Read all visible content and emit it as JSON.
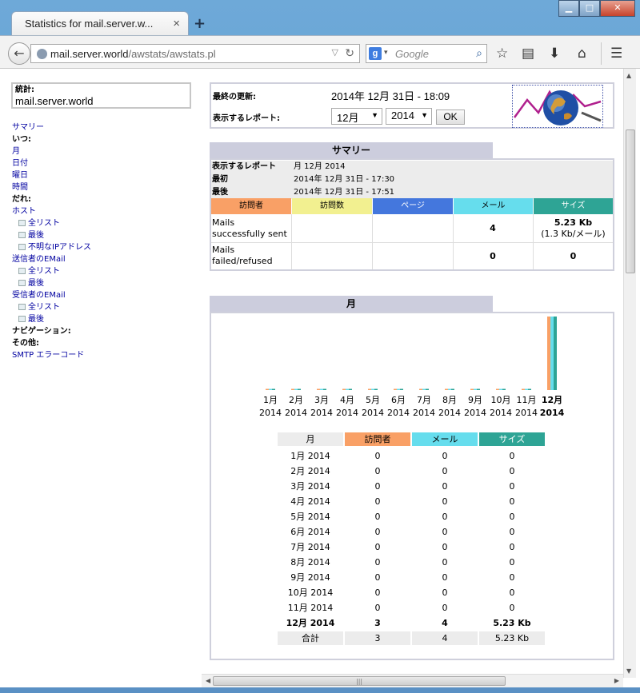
{
  "browser": {
    "tab_title": "Statistics for mail.server.w...",
    "tab_close": "×",
    "new_tab": "+",
    "url_host": "mail.server.world",
    "url_path": "/awstats/awstats.pl",
    "search_placeholder": "Google",
    "search_engine_letter": "g"
  },
  "sidebar": {
    "stats_label": "統計:",
    "hostname": "mail.server.world",
    "items": [
      {
        "type": "link",
        "label": "サマリー"
      },
      {
        "type": "header",
        "label": "いつ:"
      },
      {
        "type": "link",
        "label": "月"
      },
      {
        "type": "link",
        "label": "日付"
      },
      {
        "type": "link",
        "label": "曜日"
      },
      {
        "type": "link",
        "label": "時間"
      },
      {
        "type": "header",
        "label": "だれ:"
      },
      {
        "type": "link",
        "label": "ホスト"
      },
      {
        "type": "sub",
        "label": "全リスト"
      },
      {
        "type": "sub",
        "label": "最後"
      },
      {
        "type": "sub",
        "label": "不明なIPアドレス"
      },
      {
        "type": "link",
        "label": "送信者のEMail"
      },
      {
        "type": "sub",
        "label": "全リスト"
      },
      {
        "type": "sub",
        "label": "最後"
      },
      {
        "type": "link",
        "label": "受信者のEMail"
      },
      {
        "type": "sub",
        "label": "全リスト"
      },
      {
        "type": "sub",
        "label": "最後"
      },
      {
        "type": "header",
        "label": "ナビゲーション:"
      },
      {
        "type": "header",
        "label": "その他:"
      },
      {
        "type": "link",
        "label": "SMTP エラーコード"
      }
    ]
  },
  "header": {
    "last_update_label": "最終の更新:",
    "last_update_value": "2014年 12月 31日 - 18:09",
    "report_label": "表示するレポート:",
    "month_select": "12月",
    "year_select": "2014",
    "ok_button": "OK"
  },
  "summary": {
    "title": "サマリー",
    "rows": [
      {
        "key": "表示するレポート",
        "value": "月 12月 2014"
      },
      {
        "key": "最初",
        "value": "2014年 12月 31日 - 17:30"
      },
      {
        "key": "最後",
        "value": "2014年 12月 31日 - 17:51"
      }
    ],
    "columns": [
      "訪問者",
      "訪問数",
      "ページ",
      "メール",
      "サイズ"
    ],
    "column_colors": [
      "#f9a066",
      "#f2f090",
      "#4477dd",
      "#66dded",
      "#2ea495"
    ],
    "sent": {
      "label1": "Mails",
      "label2": "successfully sent",
      "mails": "4",
      "size": "5.23 Kb",
      "size_per": "(1.3 Kb/メール)"
    },
    "failed": {
      "label1": "Mails",
      "label2": "failed/refused",
      "mails": "0",
      "size": "0"
    }
  },
  "monthly": {
    "title": "月",
    "columns": [
      "月",
      "訪問者",
      "メール",
      "サイズ"
    ],
    "rows": [
      {
        "month": "1月 2014",
        "visitors": "0",
        "mails": "0",
        "size": "0"
      },
      {
        "month": "2月 2014",
        "visitors": "0",
        "mails": "0",
        "size": "0"
      },
      {
        "month": "3月 2014",
        "visitors": "0",
        "mails": "0",
        "size": "0"
      },
      {
        "month": "4月 2014",
        "visitors": "0",
        "mails": "0",
        "size": "0"
      },
      {
        "month": "5月 2014",
        "visitors": "0",
        "mails": "0",
        "size": "0"
      },
      {
        "month": "6月 2014",
        "visitors": "0",
        "mails": "0",
        "size": "0"
      },
      {
        "month": "7月 2014",
        "visitors": "0",
        "mails": "0",
        "size": "0"
      },
      {
        "month": "8月 2014",
        "visitors": "0",
        "mails": "0",
        "size": "0"
      },
      {
        "month": "9月 2014",
        "visitors": "0",
        "mails": "0",
        "size": "0"
      },
      {
        "month": "10月 2014",
        "visitors": "0",
        "mails": "0",
        "size": "0"
      },
      {
        "month": "11月 2014",
        "visitors": "0",
        "mails": "0",
        "size": "0"
      },
      {
        "month": "12月 2014",
        "visitors": "3",
        "mails": "4",
        "size": "5.23 Kb",
        "bold": true
      }
    ],
    "total": {
      "label": "合計",
      "visitors": "3",
      "mails": "4",
      "size": "5.23 Kb"
    }
  },
  "chart_data": {
    "type": "bar",
    "categories": [
      "1月 2014",
      "2月 2014",
      "3月 2014",
      "4月 2014",
      "5月 2014",
      "6月 2014",
      "7月 2014",
      "8月 2014",
      "9月 2014",
      "10月 2014",
      "11月 2014",
      "12月 2014"
    ],
    "series": [
      {
        "name": "訪問者",
        "color": "#f9a066",
        "values": [
          0,
          0,
          0,
          0,
          0,
          0,
          0,
          0,
          0,
          0,
          0,
          3
        ]
      },
      {
        "name": "メール",
        "color": "#66dded",
        "values": [
          0,
          0,
          0,
          0,
          0,
          0,
          0,
          0,
          0,
          0,
          0,
          4
        ]
      },
      {
        "name": "サイズ",
        "color": "#2ea495",
        "values": [
          0,
          0,
          0,
          0,
          0,
          0,
          0,
          0,
          0,
          0,
          0,
          5.23
        ]
      }
    ]
  }
}
